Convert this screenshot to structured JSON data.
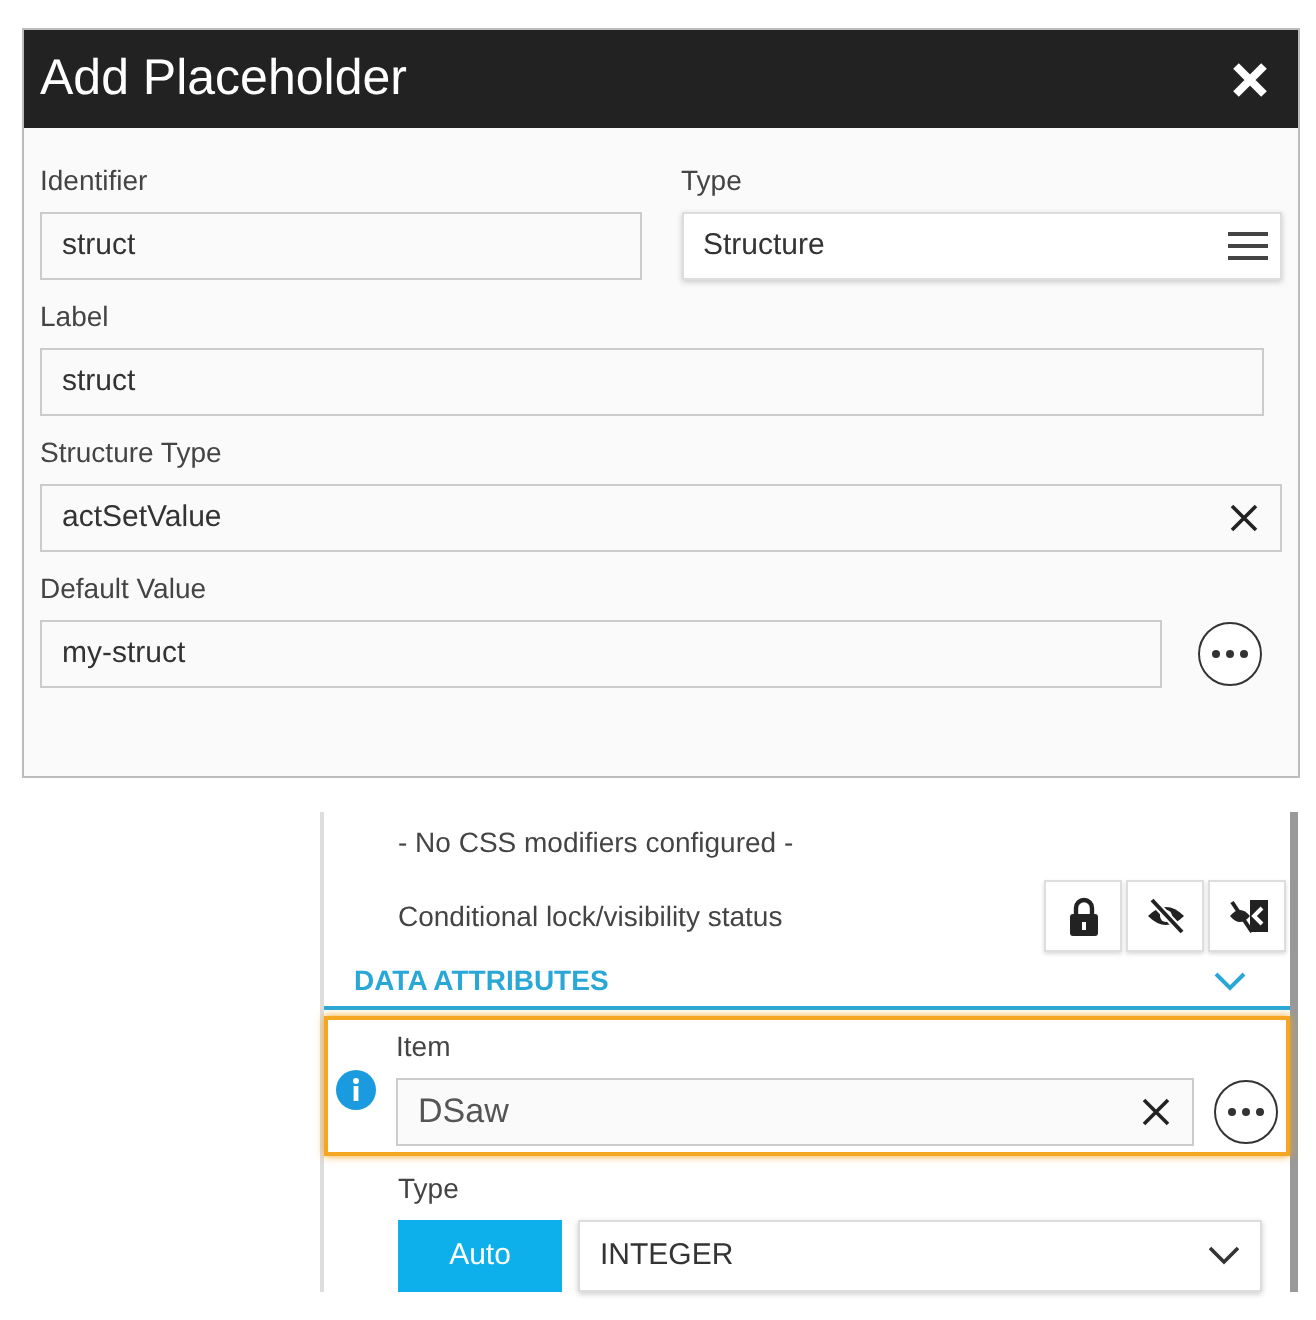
{
  "dialog": {
    "title": "Add Placeholder",
    "rows": [
      [
        {
          "label": "Identifier",
          "value": "struct",
          "kind": "text"
        },
        {
          "label": "Type",
          "value": "Structure",
          "kind": "menu"
        }
      ],
      [
        {
          "label": "Label",
          "value": "struct",
          "kind": "text"
        }
      ],
      [
        {
          "label": "Structure Type",
          "value": "actSetValue",
          "kind": "clear"
        }
      ],
      [
        {
          "label": "Default Value",
          "value": "my-struct",
          "kind": "more"
        }
      ]
    ]
  },
  "panel": {
    "css_note": "- No CSS modifiers configured -",
    "lock_label": "Conditional lock/visibility status",
    "section": {
      "title": "DATA ATTRIBUTES",
      "expanded": true
    },
    "item": {
      "label": "Item",
      "value": "DSaw",
      "highlighted": true
    },
    "type": {
      "label": "Type",
      "toggle": {
        "label": "Auto",
        "selected": true
      },
      "value": "INTEGER"
    }
  }
}
